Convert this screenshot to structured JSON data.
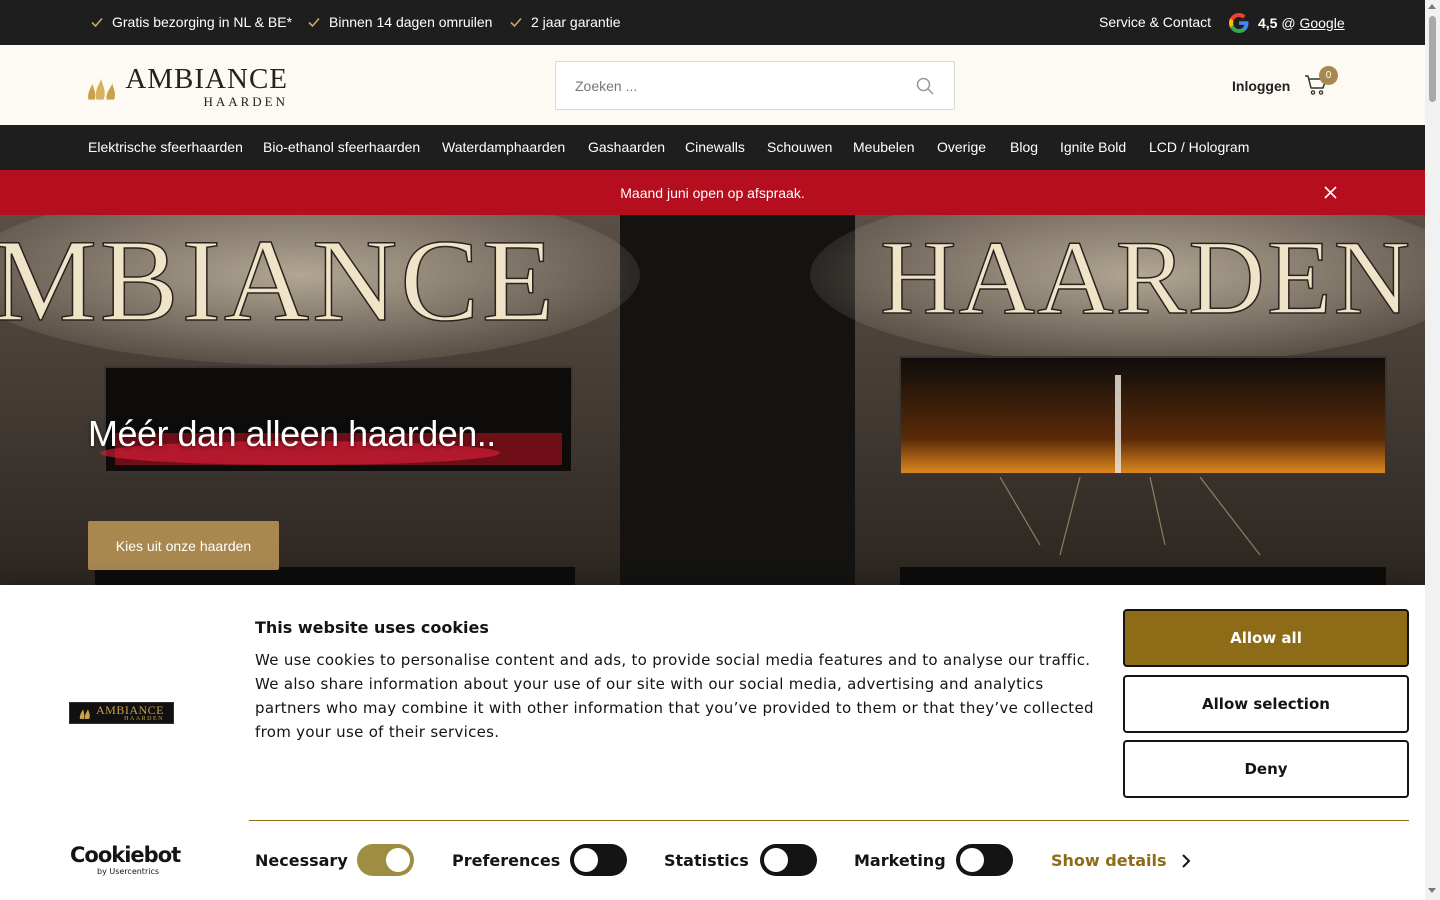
{
  "topbar": {
    "usps": [
      "Gratis bezorging in NL & BE*",
      "Binnen 14 dagen omruilen",
      "2 jaar garantie"
    ],
    "service": "Service & Contact",
    "rating": "4,5",
    "rating_at": "@",
    "rating_source": "Google"
  },
  "header": {
    "logo_main": "AMBIANCE",
    "logo_sub": "HAARDEN",
    "search_placeholder": "Zoeken ...",
    "login": "Inloggen",
    "cart_count": "0"
  },
  "nav": {
    "items": [
      "Elektrische sfeerhaarden",
      "Bio-ethanol sfeerhaarden",
      "Waterdamphaarden",
      "Gashaarden",
      "Cinewalls",
      "Schouwen",
      "Meubelen",
      "Overige",
      "Blog",
      "Ignite Bold",
      "LCD / Hologram"
    ]
  },
  "notice": {
    "text": "Maand juni open op afspraak."
  },
  "hero": {
    "sign_left": "MBIANCE",
    "sign_right": "HAARDEN",
    "title": "Méér dan alleen haarden..",
    "cta": "Kies uit onze haarden"
  },
  "cookie": {
    "logo_main": "AMBIANCE",
    "logo_sub": "HAARDEN",
    "title": "This website uses cookies",
    "text": "We use cookies to personalise content and ads, to provide social media features and to analyse our traffic. We also share information about your use of our site with our social media, advertising and analytics partners who may combine it with other information that you’ve provided to them or that they’ve collected from your use of their services.",
    "allow_all": "Allow all",
    "allow_selection": "Allow selection",
    "deny": "Deny",
    "brand": "Cookiebot",
    "brand_sub": "by Usercentrics",
    "toggles": [
      {
        "label": "Necessary",
        "on": true
      },
      {
        "label": "Preferences",
        "on": false
      },
      {
        "label": "Statistics",
        "on": false
      },
      {
        "label": "Marketing",
        "on": false
      }
    ],
    "show_details": "Show details"
  },
  "colors": {
    "accent": "#a8884f",
    "cookie_accent": "#8e6b16",
    "notice_red": "#b50e1e",
    "dark_bar": "#1e1e1e"
  }
}
